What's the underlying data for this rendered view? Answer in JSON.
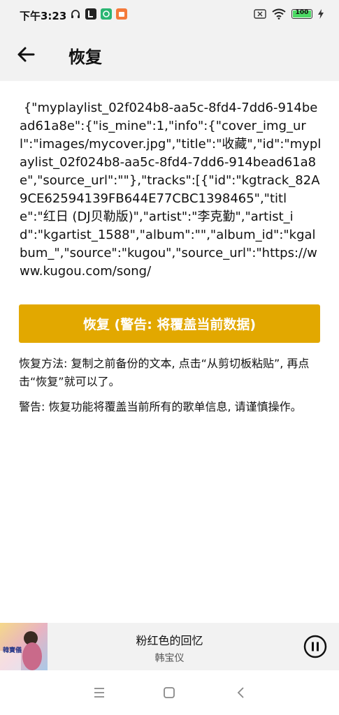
{
  "status_bar": {
    "time": "下午3:23",
    "battery_level": "100",
    "icons_left": [
      "headphones-icon",
      "app-l-icon",
      "app-green-icon",
      "app-orange-icon"
    ],
    "icons_right": [
      "sim-off-icon",
      "wifi-icon",
      "battery-icon",
      "charging-icon"
    ]
  },
  "app_bar": {
    "title": "恢复",
    "back_icon": "arrow-left-icon"
  },
  "backup_text": " {\"myplaylist_02f024b8-aa5c-8fd4-7dd6-914bead61a8e\":{\"is_mine\":1,\"info\":{\"cover_img_url\":\"images/mycover.jpg\",\"title\":\"收藏\",\"id\":\"myplaylist_02f024b8-aa5c-8fd4-7dd6-914bead61a8e\",\"source_url\":\"\"},\"tracks\":[{\"id\":\"kgtrack_82A9CE62594139FB644E77CBC1398465\",\"title\":\"红日 (DJ贝勒版)\",\"artist\":\"李克勤\",\"artist_id\":\"kgartist_1588\",\"album\":\"\",\"album_id\":\"kgalbum_\",\"source\":\"kugou\",\"source_url\":\"https://www.kugou.com/song/",
  "restore_button_label": "恢复 (警告: 将覆盖当前数据)",
  "instructions": "恢复方法: 复制之前备份的文本, 点击“从剪切板粘贴”, 再点击“恢复”就可以了。",
  "warning": "警告: 恢复功能将覆盖当前所有的歌单信息, 请谨慎操作。",
  "player": {
    "song_title": "粉红色的回忆",
    "artist": "韩宝仪",
    "cover_text": "韓寶儀",
    "play_icon": "pause-icon"
  },
  "nav_bar": {
    "items": [
      "menu-icon",
      "home-icon",
      "back-icon"
    ]
  },
  "colors": {
    "accent": "#e2a800",
    "bar_bg": "#f2f2f2"
  }
}
